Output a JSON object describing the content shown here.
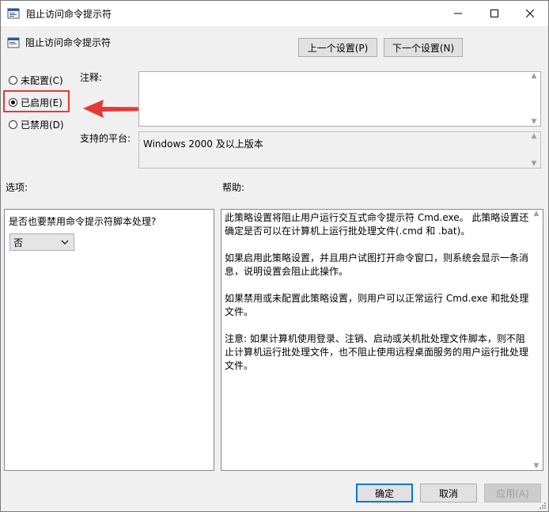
{
  "window": {
    "title": "阻止访问命令提示符"
  },
  "header": {
    "policy_name": "阻止访问命令提示符",
    "prev_button": "上一个设置(P)",
    "next_button": "下一个设置(N)"
  },
  "state": {
    "options": [
      {
        "label": "未配置(C)",
        "checked": false
      },
      {
        "label": "已启用(E)",
        "checked": true
      },
      {
        "label": "已禁用(D)",
        "checked": false
      }
    ]
  },
  "comment": {
    "label": "注释:",
    "value": ""
  },
  "platform": {
    "label": "支持的平台:",
    "value": "Windows 2000 及以上版本"
  },
  "options_section": {
    "label": "选项:",
    "question": "是否也要禁用命令提示符脚本处理?",
    "select_value": "否"
  },
  "help_section": {
    "label": "帮助:",
    "paragraphs": [
      "此策略设置将阻止用户运行交互式命令提示符 Cmd.exe。 此策略设置还确定是否可以在计算机上运行批处理文件(.cmd 和 .bat)。",
      "如果启用此策略设置，并且用户试图打开命令窗口，则系统会显示一条消息，说明设置会阻止此操作。",
      "如果禁用或未配置此策略设置，则用户可以正常运行 Cmd.exe 和批处理文件。",
      "注意: 如果计算机使用登录、注销、启动或关机批处理文件脚本，则不阻止计算机运行批处理文件，也不阻止使用远程桌面服务的用户运行批处理文件。"
    ]
  },
  "footer": {
    "ok_button": "确定",
    "cancel_button": "取消",
    "apply_button": "应用(A)"
  },
  "colors": {
    "annotation_red": "#e53935",
    "accent_blue": "#0078d7"
  }
}
